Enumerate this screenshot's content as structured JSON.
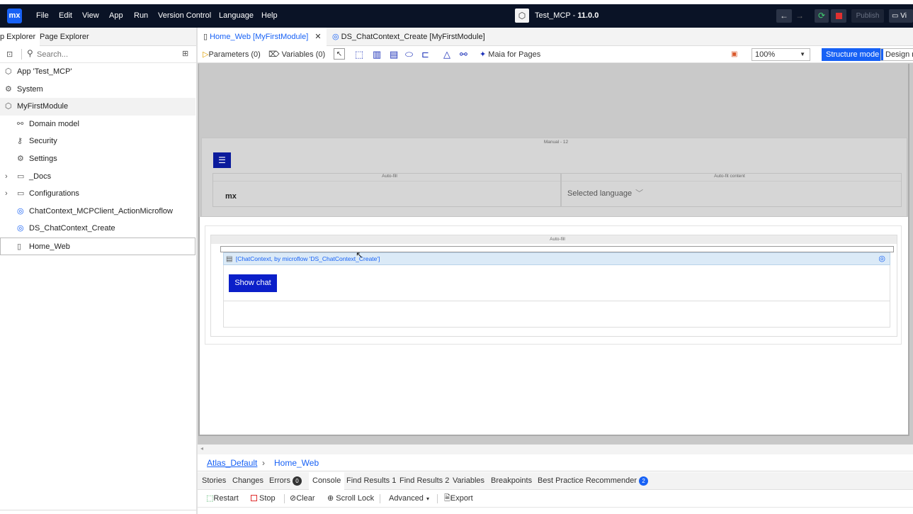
{
  "app": {
    "logo": "mx",
    "title": "Test_MCP",
    "version": "11.0.0",
    "title_separator": "-",
    "publish_label": "Publish",
    "view_label": "Vi"
  },
  "menu": [
    "File",
    "Edit",
    "View",
    "App",
    "Run",
    "Version Control",
    "Language",
    "Help"
  ],
  "left_panel": {
    "tabs": [
      "p Explorer",
      "Page Explorer"
    ],
    "search_placeholder": "Search...",
    "tree": [
      {
        "label": "App 'Test_MCP'",
        "icon": "app-icon"
      },
      {
        "label": "System",
        "icon": "system-icon"
      },
      {
        "label": "MyFirstModule",
        "icon": "module-icon"
      },
      {
        "label": "Domain model",
        "icon": "domain-model-icon"
      },
      {
        "label": "Security",
        "icon": "security-icon"
      },
      {
        "label": "Settings",
        "icon": "settings-icon"
      },
      {
        "label": "_Docs",
        "icon": "folder-icon"
      },
      {
        "label": "Configurations",
        "icon": "folder-icon"
      },
      {
        "label": "ChatContext_MCPClient_ActionMicroflow",
        "icon": "microflow-icon"
      },
      {
        "label": "DS_ChatContext_Create",
        "icon": "microflow-icon"
      },
      {
        "label": "Home_Web",
        "icon": "page-icon"
      }
    ]
  },
  "editor": {
    "tabs": [
      {
        "label": "Home_Web [MyFirstModule]",
        "active": true
      },
      {
        "label": "DS_ChatContext_Create [MyFirstModule]",
        "active": false
      }
    ],
    "toolbar": {
      "parameters": "Parameters (0)",
      "variables": "Variables (0)",
      "maia": "Maia for Pages",
      "zoom": "100%",
      "structure_mode": "Structure mode",
      "design_mode": "Design m"
    }
  },
  "canvas": {
    "layout_label": "Manual - 12",
    "autofill_label_1": "Auto-fill",
    "autofill_content_label": "Auto-fit content",
    "logo_text": "mx",
    "language_selector": "Selected language",
    "autofill_label_2": "Auto-fill",
    "dataview_header": "[ChatContext, by microflow 'DS_ChatContext_Create']",
    "show_chat_button": "Show chat"
  },
  "breadcrumb": [
    "Atlas_Default",
    "Home_Web"
  ],
  "bottom_panel": {
    "tabs": [
      "Stories",
      "Changes",
      "Errors",
      "Console",
      "Find Results 1",
      "Find Results 2",
      "Variables",
      "Breakpoints",
      "Best Practice Recommender"
    ],
    "errors_count": "0",
    "recommender_count": "2",
    "console_toolbar": [
      "Restart",
      "Stop",
      "Clear",
      "Scroll Lock",
      "Advanced",
      "Export"
    ]
  },
  "colors": {
    "menubar_bg": "#0a1326",
    "accent": "#1761f5",
    "button_primary": "#0b1fc9",
    "stop_red": "#e03030"
  }
}
